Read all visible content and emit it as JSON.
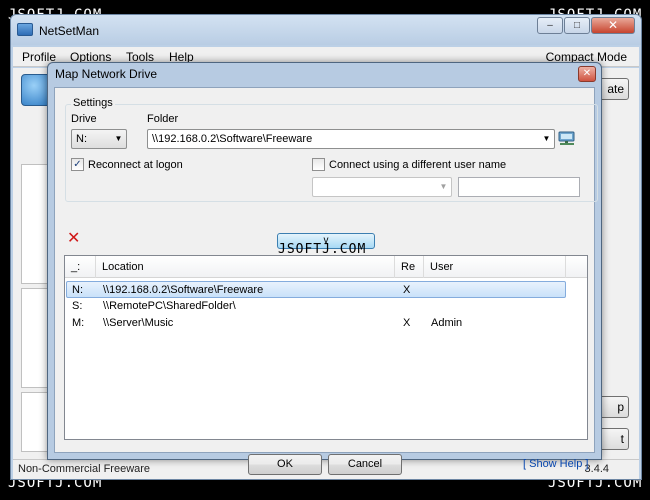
{
  "watermark": "JSOFTJ.COM",
  "main_window": {
    "title": "NetSetMan",
    "menu": [
      "Profile",
      "Options",
      "Tools",
      "Help"
    ],
    "compact_mode": "Compact Mode",
    "right_button_1": "ate",
    "right_button_2": "p",
    "right_button_3": "t",
    "status_text": "Non-Commercial Freeware",
    "version": "3.4.4"
  },
  "dialog": {
    "title": "Map Network Drive",
    "settings_label": "Settings",
    "drive_label": "Drive",
    "folder_label": "Folder",
    "drive_value": "N:",
    "folder_value": "\\\\192.168.0.2\\Software\\Freeware",
    "reconnect_label": "Reconnect at logon",
    "reconnect_checked": true,
    "different_user_label": "Connect using a different user name",
    "different_user_checked": false,
    "username_value": "",
    "password_value": "",
    "expand_label": "v",
    "columns": [
      "_:",
      "Location",
      "Re",
      "User"
    ],
    "drives": [
      {
        "letter": "N:",
        "location": "\\\\192.168.0.2\\Software\\Freeware",
        "reconnect": "X",
        "user": "",
        "selected": true
      },
      {
        "letter": "S:",
        "location": "\\\\RemotePC\\SharedFolder\\",
        "reconnect": "",
        "user": "",
        "selected": false
      },
      {
        "letter": "M:",
        "location": "\\\\Server\\Music",
        "reconnect": "X",
        "user": "Admin",
        "selected": false
      }
    ],
    "ok_label": "OK",
    "cancel_label": "Cancel",
    "help_label": "[ Show Help ]"
  }
}
